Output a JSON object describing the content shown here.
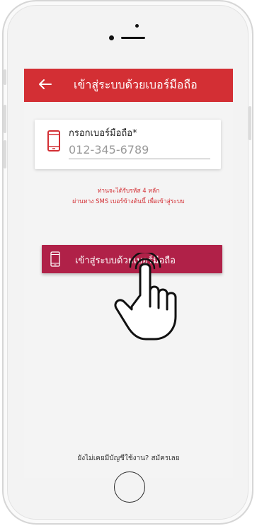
{
  "header": {
    "title": "เข้าสู่ระบบด้วยเบอร์มือถือ",
    "back_icon": "arrow-left-icon"
  },
  "phone_input": {
    "label": "กรอกเบอร์มือถือ*",
    "placeholder": "012-345-6789",
    "icon": "mobile-phone-icon"
  },
  "info": {
    "line1": "ท่านจะได้รับรหัส 4 หลัก",
    "line2": "ผ่านทาง SMS เบอร์ข้างต้นนี้ เพื่อเข้าสู่ระบบ"
  },
  "login_button": {
    "label": "เข้าสู่ระบบด้วยเบอร์มือถือ",
    "icon": "mobile-phone-icon"
  },
  "signup": {
    "text": "ยังไม่เคยมีบัญชีใช้งาน? สมัครเลย"
  },
  "colors": {
    "header_red": "#d32f34",
    "button_crimson": "#b02148",
    "info_red": "#d32f34",
    "screen_bg": "#f4f4f4"
  }
}
